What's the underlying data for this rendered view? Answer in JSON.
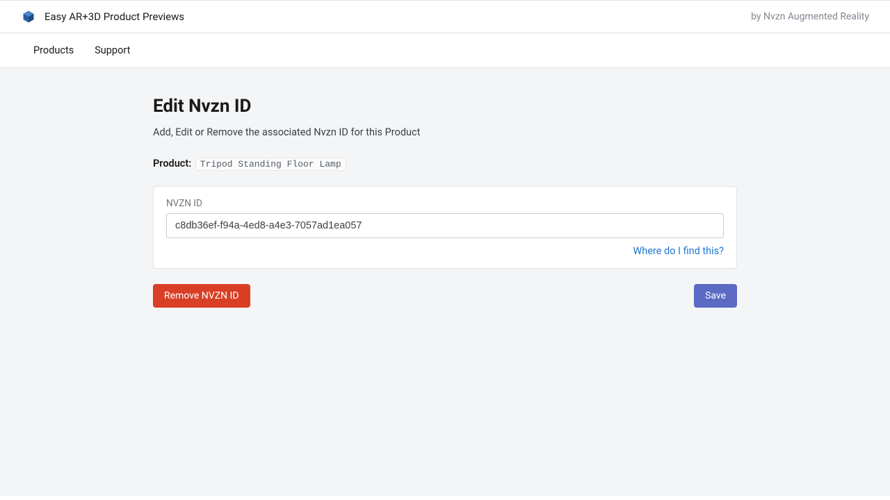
{
  "header": {
    "app_title": "Easy AR+3D Product Previews",
    "byline": "by Nvzn Augmented Reality"
  },
  "nav": {
    "products": "Products",
    "support": "Support"
  },
  "main": {
    "title": "Edit Nvzn ID",
    "subtitle": "Add, Edit or Remove the associated Nvzn ID for this Product",
    "product_label": "Product:",
    "product_name": "Tripod Standing Floor Lamp",
    "field_label": "NVZN ID",
    "field_value": "c8db36ef-f94a-4ed8-a4e3-7057ad1ea057",
    "help_link": "Where do I find this?"
  },
  "buttons": {
    "remove": "Remove NVZN ID",
    "save": "Save"
  }
}
